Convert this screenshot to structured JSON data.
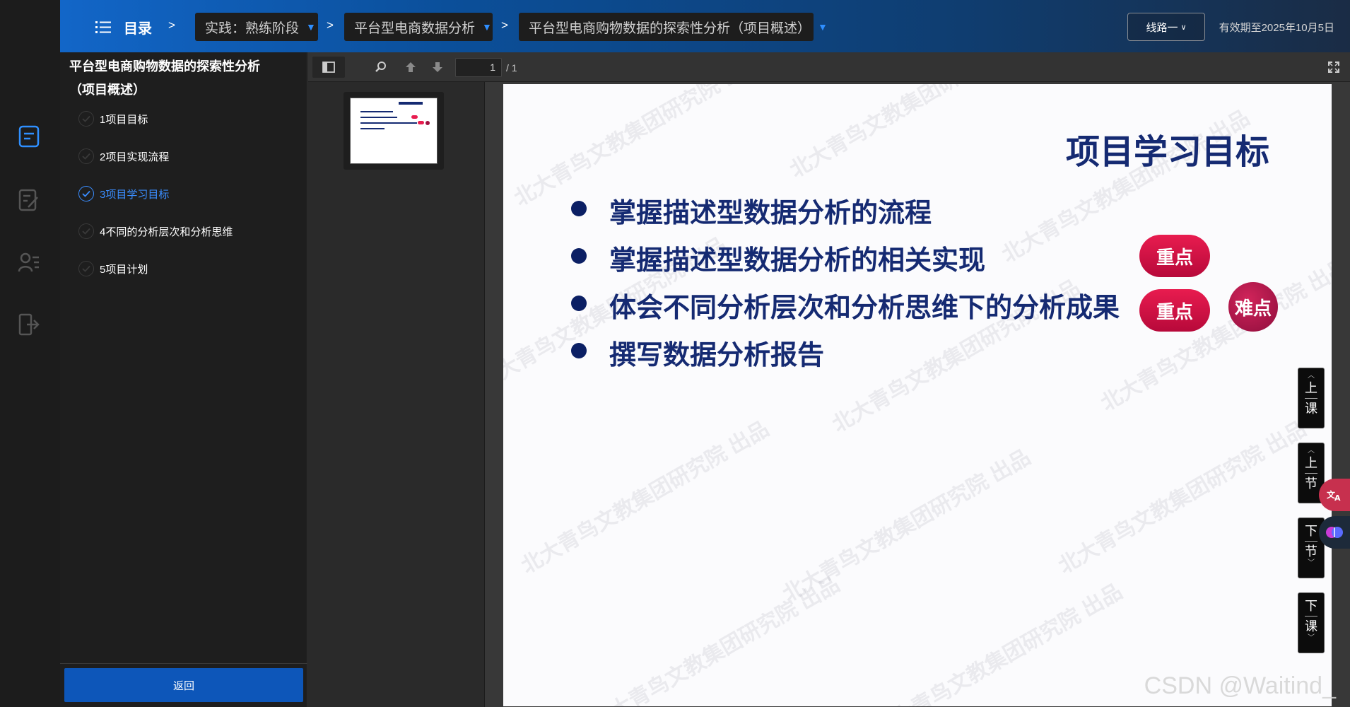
{
  "header": {
    "toc_label": "目录",
    "separator": ">",
    "breadcrumbs": [
      {
        "label": "实践：熟练阶段"
      },
      {
        "label": "平台型电商数据分析"
      },
      {
        "label": "平台型电商购物数据的探索性分析（项目概述）"
      }
    ],
    "line_select": "线路一",
    "validity": "有效期至2025年10月5日"
  },
  "panel": {
    "title": "平台型电商购物数据的探索性分析（项目概述）",
    "items": [
      {
        "label": "1项目目标"
      },
      {
        "label": "2项目实现流程"
      },
      {
        "label": "3项目学习目标"
      },
      {
        "label": "4不同的分析层次和分析思维"
      },
      {
        "label": "5项目计划"
      }
    ],
    "back_label": "返回"
  },
  "viewer": {
    "page_current": "1",
    "page_total": "/ 1"
  },
  "slide": {
    "title": "项目学习目标",
    "bullets": [
      "掌握描述型数据分析的流程",
      "掌握描述型数据分析的相关实现",
      "体会不同分析层次和分析思维下的分析成果",
      "撰写数据分析报告"
    ],
    "tag_key": "重点",
    "tag_difficult": "难点",
    "watermark": "北大青鸟文教集团研究院 出品"
  },
  "float_nav": {
    "prev_lesson": [
      "上",
      "课"
    ],
    "prev_section": [
      "上",
      "节"
    ],
    "next_section": [
      "下",
      "节"
    ],
    "next_lesson": [
      "下",
      "课"
    ]
  },
  "footer_watermark": "CSDN @Waitind_",
  "colors": {
    "accent": "#0d56b9",
    "active": "#3a8dff",
    "slide_text": "#152a72",
    "tag": "#e81c4f"
  }
}
